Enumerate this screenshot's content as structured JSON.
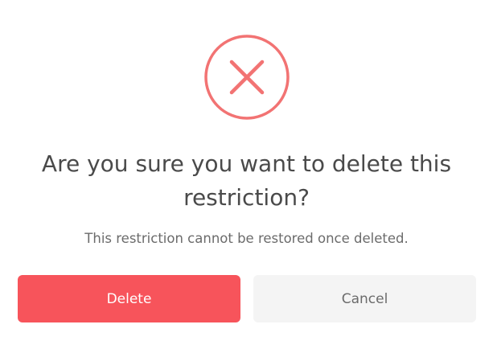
{
  "dialog": {
    "icon": "close-circle-icon",
    "title": "Are you sure you want to delete this restriction?",
    "message": "This restriction cannot be restored once deleted.",
    "delete_label": "Delete",
    "cancel_label": "Cancel"
  },
  "colors": {
    "accent": "#f27373",
    "delete_button": "#f7545b",
    "cancel_button": "#f4f4f4",
    "title_text": "#4a4a4a",
    "message_text": "#6b6b6b"
  }
}
